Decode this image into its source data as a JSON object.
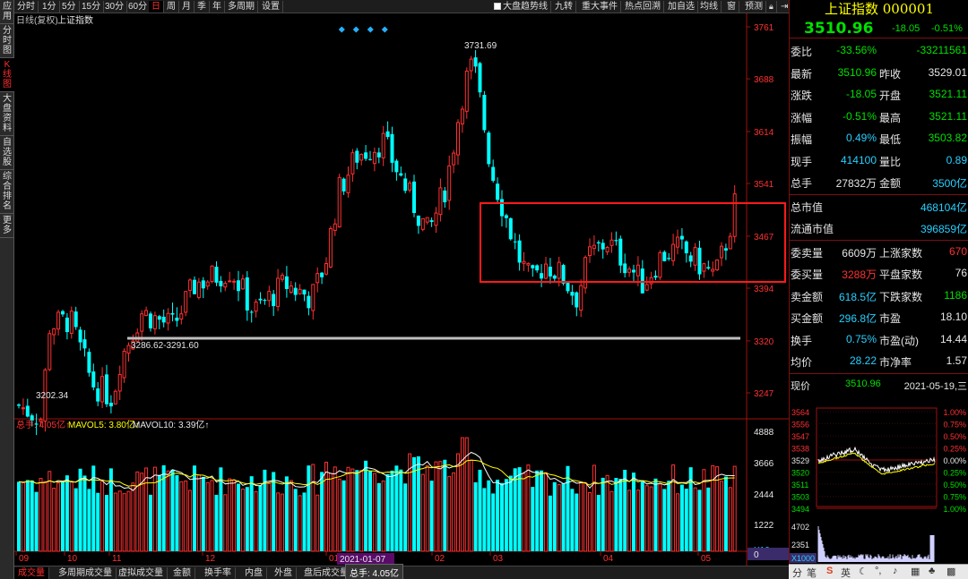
{
  "left_tabs": [
    {
      "label": "应用",
      "name": "app"
    },
    {
      "label": "分时图",
      "name": "intraday"
    },
    {
      "label": "K线图",
      "name": "kline",
      "active": true
    },
    {
      "label": "大盘资料",
      "name": "market-info"
    },
    {
      "label": "自选股",
      "name": "watchlist"
    },
    {
      "label": "综合排名",
      "name": "ranking"
    },
    {
      "label": "更多",
      "name": "more"
    }
  ],
  "toolbar": {
    "periods": [
      "分时",
      "1分",
      "5分",
      "15分",
      "30分",
      "60分",
      "日",
      "周",
      "月",
      "季",
      "年",
      "多周期",
      "设置"
    ],
    "selected_period": "日",
    "checkbox_label": "大盘趋势线",
    "tools": [
      "九转",
      "重大事件",
      "热点回溯",
      "加自选",
      "均线",
      "窗",
      "预测"
    ],
    "icons": [
      "lock-icon",
      "arrow-right-icon"
    ]
  },
  "chart_header": {
    "period_label": "日线(复权)",
    "name": "上证指数",
    "volume_legend": {
      "total": "总手: 4.05亿↑",
      "mavol5": "MAVOL5: 3.80亿↑",
      "mavol10": "MAVOL10: 3.39亿↑"
    }
  },
  "price_axis": [
    "3761",
    "3688",
    "3614",
    "3541",
    "3467",
    "3394",
    "3320",
    "3247"
  ],
  "volume_axis": [
    "4888",
    "3666",
    "2444",
    "1222",
    "X10"
  ],
  "x_axis": [
    "09",
    "10",
    "11",
    "12",
    "01",
    "02",
    "03",
    "04",
    "05"
  ],
  "cursor_date": "2021-01-07",
  "annotations": {
    "high": "3731.69",
    "low": "3202.34",
    "hline": "3286.62-3291.60"
  },
  "colors": {
    "up": "#ff3030",
    "down": "#00ffff",
    "ma_white": "#ffffff",
    "ma_yellow": "#ffff00",
    "highlight_box": "#ff1a1a"
  },
  "chart_data": {
    "type": "candlestick",
    "title": "上证指数",
    "ylim": [
      3200,
      3770
    ],
    "volume_ylim": [
      0,
      5000
    ],
    "series": [
      {
        "name": "MAVOL5",
        "latest": "3.80亿"
      },
      {
        "name": "MAVOL10",
        "latest": "3.39亿"
      }
    ],
    "x_month_labels": [
      "09",
      "10",
      "11",
      "12",
      "01",
      "02",
      "03",
      "04",
      "05"
    ],
    "high_annotation": 3731.69,
    "low_annotation": 3202.34
  },
  "bottom_tabs": [
    "成交量",
    "多周期成交量",
    "虚拟成交量",
    "金额",
    "换手率",
    "内盘",
    "外盘",
    "盘后成交量"
  ],
  "bottom_cursor": "总手: 4.05亿",
  "quote": {
    "title": "上证指数 000001",
    "price": "3510.96",
    "change": "-18.05",
    "pct": "-0.51%",
    "rows": [
      {
        "l1": "委比",
        "v1": "-33.56%",
        "c1": "green",
        "l2": "",
        "v2": "-33211561",
        "c2": "green"
      },
      {
        "l1": "最新",
        "v1": "3510.96",
        "c1": "green",
        "l2": "昨收",
        "v2": "3529.01",
        "c2": "white"
      },
      {
        "l1": "涨跌",
        "v1": "-18.05",
        "c1": "green",
        "l2": "开盘",
        "v2": "3521.11",
        "c2": "green"
      },
      {
        "l1": "涨幅",
        "v1": "-0.51%",
        "c1": "green",
        "l2": "最高",
        "v2": "3521.11",
        "c2": "green"
      },
      {
        "l1": "振幅",
        "v1": "0.49%",
        "c1": "cyan",
        "l2": "最低",
        "v2": "3503.82",
        "c2": "green"
      },
      {
        "l1": "现手",
        "v1": "414100",
        "c1": "cyan",
        "l2": "量比",
        "v2": "0.89",
        "c2": "cyan"
      },
      {
        "l1": "总手",
        "v1": "27832万",
        "c1": "white",
        "l2": "金额",
        "v2": "3500亿",
        "c2": "cyan"
      }
    ],
    "rows2": [
      {
        "l1": "总市值",
        "v1": "468104亿",
        "c1": "cyan"
      },
      {
        "l1": "流通市值",
        "v1": "396859亿",
        "c1": "cyan"
      }
    ],
    "rows3": [
      {
        "l1": "委卖量",
        "v1": "6609万",
        "c1": "white",
        "l2": "上涨家数",
        "v2": "670",
        "c2": "red"
      },
      {
        "l1": "委买量",
        "v1": "3288万",
        "c1": "red",
        "l2": "平盘家数",
        "v2": "76",
        "c2": "white"
      },
      {
        "l1": "卖金额",
        "v1": "618.5亿",
        "c1": "cyan",
        "l2": "下跌家数",
        "v2": "1186",
        "c2": "green"
      },
      {
        "l1": "买金额",
        "v1": "296.8亿",
        "c1": "cyan",
        "l2": "市盈",
        "v2": "18.10",
        "c2": "white"
      },
      {
        "l1": "换手",
        "v1": "0.75%",
        "c1": "cyan",
        "l2": "市盈(动)",
        "v2": "14.44",
        "c2": "white"
      },
      {
        "l1": "均价",
        "v1": "28.22",
        "c1": "cyan",
        "l2": "市净率",
        "v2": "1.57",
        "c2": "white"
      }
    ],
    "now_label": "现价",
    "now_value": "3510.96",
    "now_date": "2021-05-19,三"
  },
  "mini_chart": {
    "prices": [
      "3564",
      "3556",
      "3547",
      "3538",
      "3529",
      "3520",
      "3511",
      "3503",
      "3494"
    ],
    "pcts": [
      "1.00%",
      "0.75%",
      "0.50%",
      "0.25%",
      "0.00%",
      "0.25%",
      "0.50%",
      "0.75%",
      "1.00%"
    ],
    "vol_labels": [
      "4702",
      "2351",
      "X1000"
    ]
  },
  "taskbar": {
    "tab": "分",
    "tab2": "笔",
    "ime": "英"
  }
}
